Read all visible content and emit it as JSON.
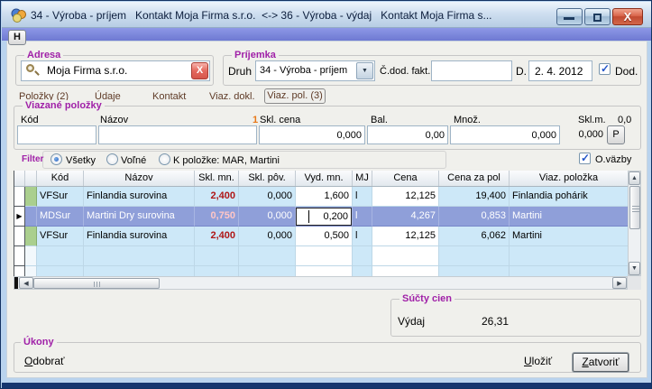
{
  "window": {
    "title": "34 - Výroba - príjem   Kontakt Moja Firma s.r.o.  <-> 36 - Výroba - výdaj   Kontakt Moja Firma s...",
    "app_icon": "app-icon",
    "controls": {
      "minimize": "minimize-icon",
      "maximize": "maximize-icon",
      "close": "close-icon"
    }
  },
  "toolbar": {
    "h_button": "H"
  },
  "adresa": {
    "legend": "Adresa",
    "value": "Moja Firma s.r.o.",
    "search_icon": "search-icon",
    "clear_icon": "close-icon"
  },
  "prijemka": {
    "legend": "Príjemka",
    "druh_label": "Druh",
    "druh_value": "34 - Výroba - príjem",
    "cdod_label": "Č.dod. fakt.",
    "cdod_value": "",
    "d_label": "D.",
    "date_value": "2. 4. 2012",
    "dod_label": "Dod.",
    "dod_checked": true
  },
  "tabs": [
    {
      "label": "Položky (2)",
      "active": false
    },
    {
      "label": "Údaje",
      "active": false
    },
    {
      "label": "Kontakt",
      "active": false
    },
    {
      "label": "Viaz. dokl.",
      "active": false
    },
    {
      "label": "Viaz. pol. (3)",
      "active": true
    }
  ],
  "viazane": {
    "legend": "Viazané položky",
    "sort_indicator": "1",
    "fields": [
      {
        "label": "Kód",
        "value": ""
      },
      {
        "label": "Názov",
        "value": ""
      },
      {
        "label": "Skl. cena",
        "value": "0,000"
      },
      {
        "label": "Bal.",
        "value": "0,00"
      },
      {
        "label": "Množ.",
        "value": "0,000"
      }
    ],
    "sklm_label": "Skl.m.",
    "sklm_top_value": "0,0",
    "sklm_value": "0,000",
    "p_button": "P"
  },
  "filter": {
    "label": "Filter",
    "options": [
      {
        "label": "Všetky",
        "selected": true
      },
      {
        "label": "Voľné",
        "selected": false
      },
      {
        "label": "K položke: MAR, Martini",
        "selected": false
      }
    ],
    "ovazby_label": "O.väzby",
    "ovazby_checked": true
  },
  "table": {
    "columns": [
      "Kód",
      "Názov",
      "Skl. mn.",
      "Skl. pôv.",
      "Vyd. mn.",
      "MJ",
      "Cena",
      "Cena za pol",
      "Viaz. položka"
    ],
    "rows": [
      {
        "kod": "VFSur",
        "nazov": "Finlandia surovina",
        "skl_mn": "2,400",
        "skl_pov": "0,000",
        "vyd_mn": "1,600",
        "mj": "l",
        "cena": "12,125",
        "cena_za_pol": "19,400",
        "viaz_polozka": "Finlandia pohárik",
        "selected": false,
        "editing": false
      },
      {
        "kod": "MDSur",
        "nazov": "Martini Dry surovina",
        "skl_mn": "0,750",
        "skl_pov": "0,000",
        "vyd_mn": "0,200",
        "mj": "l",
        "cena": "4,267",
        "cena_za_pol": "0,853",
        "viaz_polozka": "Martini",
        "selected": true,
        "editing": true
      },
      {
        "kod": "VFSur",
        "nazov": "Finlandia surovina",
        "skl_mn": "2,400",
        "skl_pov": "0,000",
        "vyd_mn": "0,500",
        "mj": "l",
        "cena": "12,125",
        "cena_za_pol": "6,062",
        "viaz_polozka": "Martini",
        "selected": false,
        "editing": false
      }
    ]
  },
  "sucty": {
    "legend": "Súčty cien",
    "vydaj_label": "Výdaj",
    "vydaj_value": "26,31"
  },
  "ukony": {
    "legend": "Úkony",
    "odobrat": "Odobrať",
    "ulozit": "Uložiť",
    "zatvorit": "Zatvoriť"
  },
  "colors": {
    "accent_strip": "#7b86d9",
    "selected_row": "#8f9fd9",
    "stock_red": "#b01616",
    "legend_magenta": "#a021a8",
    "cell_blue": "#cde8f8"
  }
}
